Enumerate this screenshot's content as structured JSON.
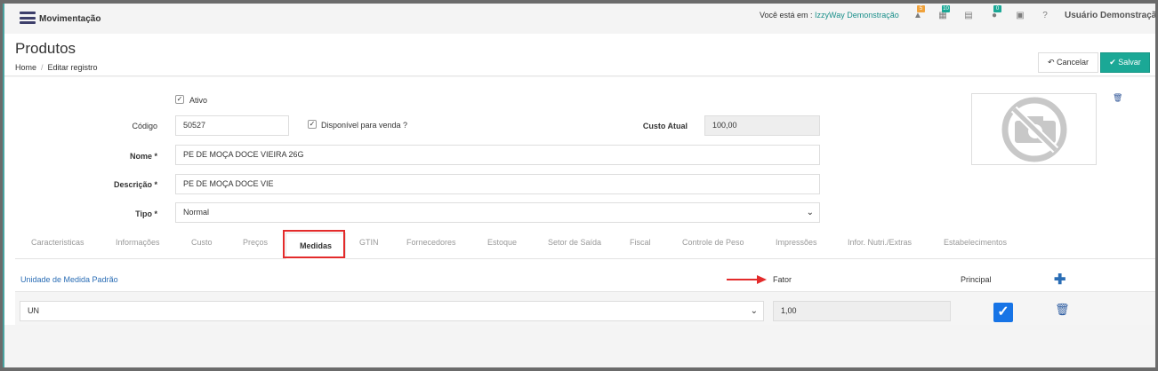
{
  "topbar": {
    "module": "Movimentação",
    "location_prefix": "Você está em : ",
    "location_value": "IzzyWay Demonstração",
    "badges": [
      "5",
      "10",
      "0"
    ],
    "user": "Usuário Demonstração"
  },
  "header": {
    "title": "Produtos",
    "breadcrumb_home": "Home",
    "breadcrumb_sep": "/",
    "breadcrumb_current": "Editar registro",
    "cancel_label": "Cancelar",
    "save_label": "Salvar"
  },
  "form": {
    "ativo_label": "Ativo",
    "codigo_label": "Código",
    "codigo_value": "50527",
    "disponivel_label": "Disponível para venda ?",
    "custo_label": "Custo Atual",
    "custo_value": "100,00",
    "nome_label": "Nome *",
    "nome_value": "PE DE MOÇA DOCE VIEIRA 26G",
    "descricao_label": "Descrição *",
    "descricao_value": "PE DE MOÇA DOCE VIE",
    "tipo_label": "Tipo *",
    "tipo_value": "Normal"
  },
  "tabs": [
    "Caracteristicas",
    "Informações",
    "Custo",
    "Preços",
    "Medidas",
    "GTIN",
    "Fornecedores",
    "Estoque",
    "Setor de Saída",
    "Fiscal",
    "Controle de Peso",
    "Impressões",
    "Infor. Nutri./Extras",
    "Estabelecimentos"
  ],
  "medidas": {
    "col_unidade": "Unidade de Medida Padrão",
    "col_fator": "Fator",
    "col_principal": "Principal",
    "row_unidade": "UN",
    "row_fator": "1,00"
  },
  "colors": {
    "accent": "#1ba896",
    "link": "#2a6db5",
    "highlight": "#e32b2b"
  }
}
